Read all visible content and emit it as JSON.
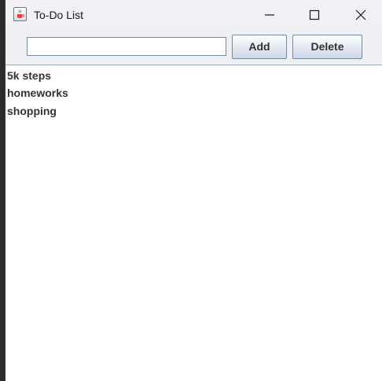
{
  "window": {
    "title": "To-Do List",
    "icon": "java-coffee-cup-icon"
  },
  "controls": {
    "minimize_icon": "minimize-icon",
    "maximize_icon": "maximize-icon",
    "close_icon": "close-icon"
  },
  "toolbar": {
    "input_value": "",
    "add_label": "Add",
    "delete_label": "Delete"
  },
  "tasks": [
    {
      "label": "5k steps"
    },
    {
      "label": "homeworks"
    },
    {
      "label": "shopping"
    }
  ],
  "colors": {
    "titlebar": "#f0f0f5",
    "toolbar": "#eef0f4",
    "text": "#333333"
  }
}
